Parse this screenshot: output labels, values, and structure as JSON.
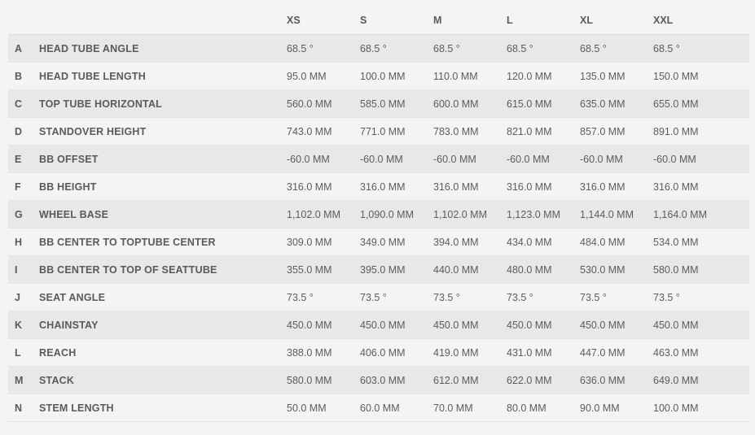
{
  "sizes": [
    "XS",
    "S",
    "M",
    "L",
    "XL",
    "XXL"
  ],
  "rows": [
    {
      "letter": "A",
      "name": "HEAD TUBE ANGLE",
      "values": [
        "68.5 °",
        "68.5 °",
        "68.5 °",
        "68.5 °",
        "68.5 °",
        "68.5 °"
      ]
    },
    {
      "letter": "B",
      "name": "HEAD TUBE LENGTH",
      "values": [
        "95.0 MM",
        "100.0 MM",
        "110.0 MM",
        "120.0 MM",
        "135.0 MM",
        "150.0 MM"
      ]
    },
    {
      "letter": "C",
      "name": "TOP TUBE HORIZONTAL",
      "values": [
        "560.0 MM",
        "585.0 MM",
        "600.0 MM",
        "615.0 MM",
        "635.0 MM",
        "655.0 MM"
      ]
    },
    {
      "letter": "D",
      "name": "STANDOVER HEIGHT",
      "values": [
        "743.0 MM",
        "771.0 MM",
        "783.0 MM",
        "821.0 MM",
        "857.0 MM",
        "891.0 MM"
      ]
    },
    {
      "letter": "E",
      "name": "BB OFFSET",
      "values": [
        "-60.0 MM",
        "-60.0 MM",
        "-60.0 MM",
        "-60.0 MM",
        "-60.0 MM",
        "-60.0 MM"
      ]
    },
    {
      "letter": "F",
      "name": "BB HEIGHT",
      "values": [
        "316.0 MM",
        "316.0 MM",
        "316.0 MM",
        "316.0 MM",
        "316.0 MM",
        "316.0 MM"
      ]
    },
    {
      "letter": "G",
      "name": "WHEEL BASE",
      "values": [
        "1,102.0 MM",
        "1,090.0 MM",
        "1,102.0 MM",
        "1,123.0 MM",
        "1,144.0 MM",
        "1,164.0 MM"
      ]
    },
    {
      "letter": "H",
      "name": "BB CENTER TO TOPTUBE CENTER",
      "values": [
        "309.0 MM",
        "349.0 MM",
        "394.0 MM",
        "434.0 MM",
        "484.0 MM",
        "534.0 MM"
      ]
    },
    {
      "letter": "I",
      "name": "BB CENTER TO TOP OF SEATTUBE",
      "values": [
        "355.0 MM",
        "395.0 MM",
        "440.0 MM",
        "480.0 MM",
        "530.0 MM",
        "580.0 MM"
      ]
    },
    {
      "letter": "J",
      "name": "SEAT ANGLE",
      "values": [
        "73.5 °",
        "73.5 °",
        "73.5 °",
        "73.5 °",
        "73.5 °",
        "73.5 °"
      ]
    },
    {
      "letter": "K",
      "name": "CHAINSTAY",
      "values": [
        "450.0 MM",
        "450.0 MM",
        "450.0 MM",
        "450.0 MM",
        "450.0 MM",
        "450.0 MM"
      ]
    },
    {
      "letter": "L",
      "name": "REACH",
      "values": [
        "388.0 MM",
        "406.0 MM",
        "419.0 MM",
        "431.0 MM",
        "447.0 MM",
        "463.0 MM"
      ]
    },
    {
      "letter": "M",
      "name": "STACK",
      "values": [
        "580.0 MM",
        "603.0 MM",
        "612.0 MM",
        "622.0 MM",
        "636.0 MM",
        "649.0 MM"
      ]
    },
    {
      "letter": "N",
      "name": "STEM LENGTH",
      "values": [
        "50.0 MM",
        "60.0 MM",
        "70.0 MM",
        "80.0 MM",
        "90.0 MM",
        "100.0 MM"
      ]
    }
  ]
}
